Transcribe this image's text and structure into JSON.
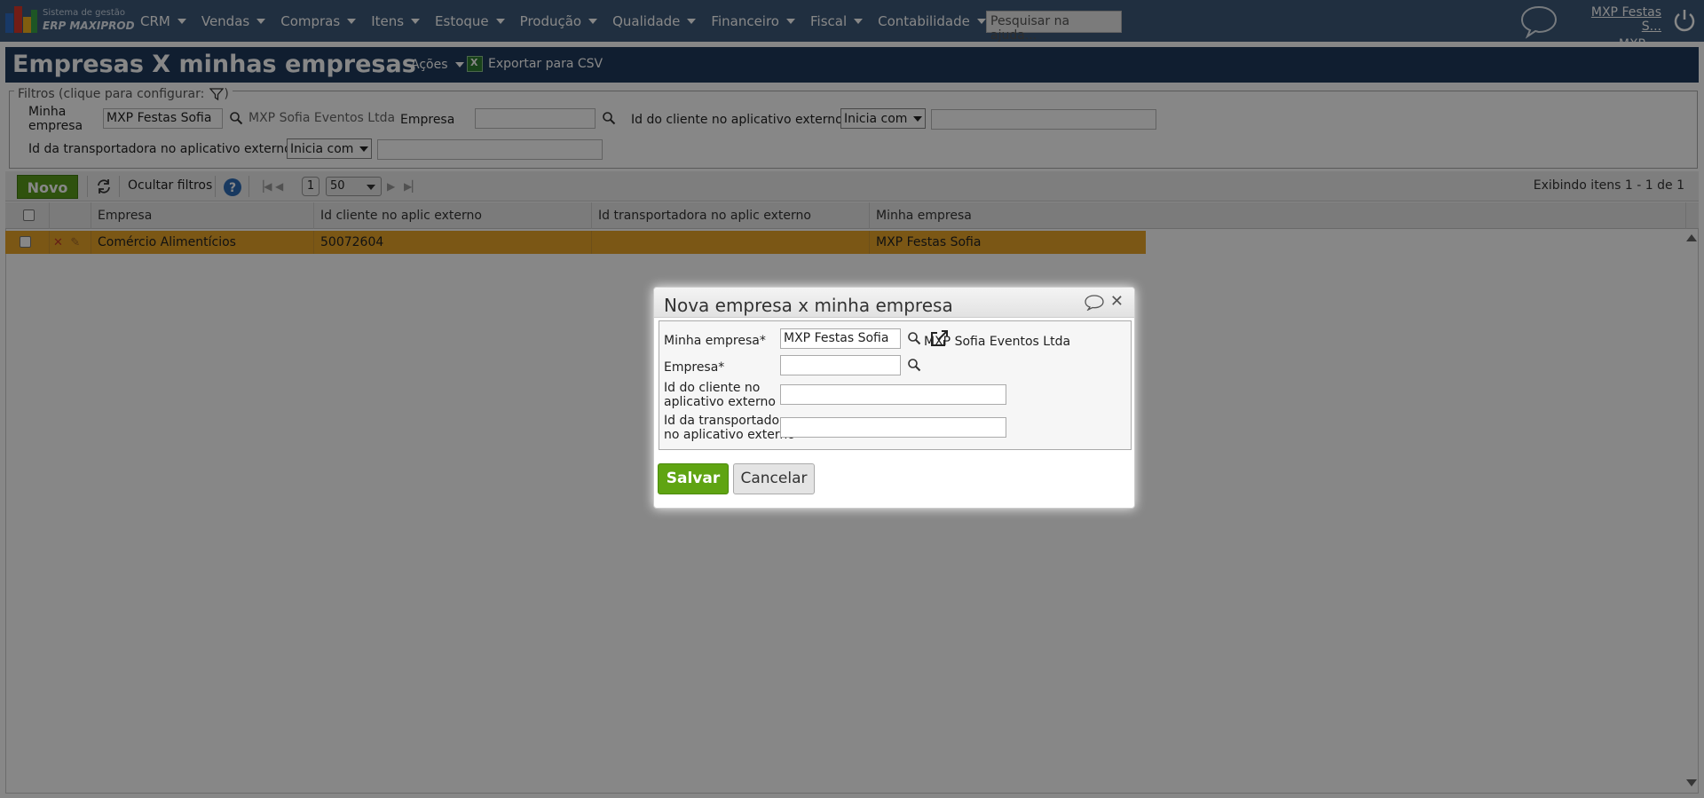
{
  "brand": {
    "line1": "Sistema de gestão",
    "line2": "ERP MAXIPROD"
  },
  "nav": {
    "items": [
      "CRM",
      "Vendas",
      "Compras",
      "Itens",
      "Estoque",
      "Produção",
      "Qualidade",
      "Financeiro",
      "Fiscal",
      "Contabilidade"
    ],
    "help_search_placeholder": "Pesquisar na ajuda...",
    "user_name": "MXP Festas S...",
    "user_company": "MXP"
  },
  "page": {
    "title": "Empresas X minhas empresas",
    "actions_label": "Ações",
    "export_label": "Exportar para CSV"
  },
  "filters": {
    "legend": "Filtros (clique para configurar:",
    "legend_close": ")",
    "minha_empresa_label": "Minha empresa",
    "minha_empresa_value": "MXP Festas Sofia",
    "minha_empresa_desc": "MXP Sofia Eventos Ltda",
    "empresa_label": "Empresa",
    "empresa_value": "",
    "id_cliente_label": "Id do cliente no aplicativo externo",
    "id_cliente_op": "Inicia com",
    "id_cliente_value": "",
    "id_transp_label": "Id da transportadora no aplicativo externo",
    "id_transp_op": "Inicia com",
    "id_transp_value": ""
  },
  "toolbar": {
    "new_label": "Novo",
    "hide_filters_label": "Ocultar filtros",
    "page": "1",
    "page_size": "50",
    "showing": "Exibindo itens 1 - 1 de 1"
  },
  "grid": {
    "columns": [
      "Empresa",
      "Id cliente no aplic externo",
      "Id transportadora no aplic externo",
      "Minha empresa"
    ],
    "rows": [
      {
        "empresa": "Comércio Alimentícios",
        "id_cliente": "50072604",
        "id_transp": "",
        "minha_empresa": "MXP Festas Sofia"
      }
    ]
  },
  "dialog": {
    "title": "Nova empresa x minha empresa",
    "minha_empresa_label": "Minha empresa*",
    "minha_empresa_value": "MXP Festas Sofia",
    "minha_empresa_desc": "MXP Sofia Eventos Ltda",
    "empresa_label": "Empresa*",
    "empresa_value": "",
    "id_cliente_label_1": "Id do cliente no",
    "id_cliente_label_2": "aplicativo externo",
    "id_cliente_value": "",
    "id_transp_label_1": "Id da transportadora",
    "id_transp_label_2": "no aplicativo externo",
    "id_transp_value": "",
    "save_label": "Salvar",
    "cancel_label": "Cancelar"
  },
  "colors": {
    "topbar": "#3d5a7a",
    "titlebar": "#1f3a5c",
    "selected_row": "#e8a528",
    "primary_button": "#5fa412"
  }
}
